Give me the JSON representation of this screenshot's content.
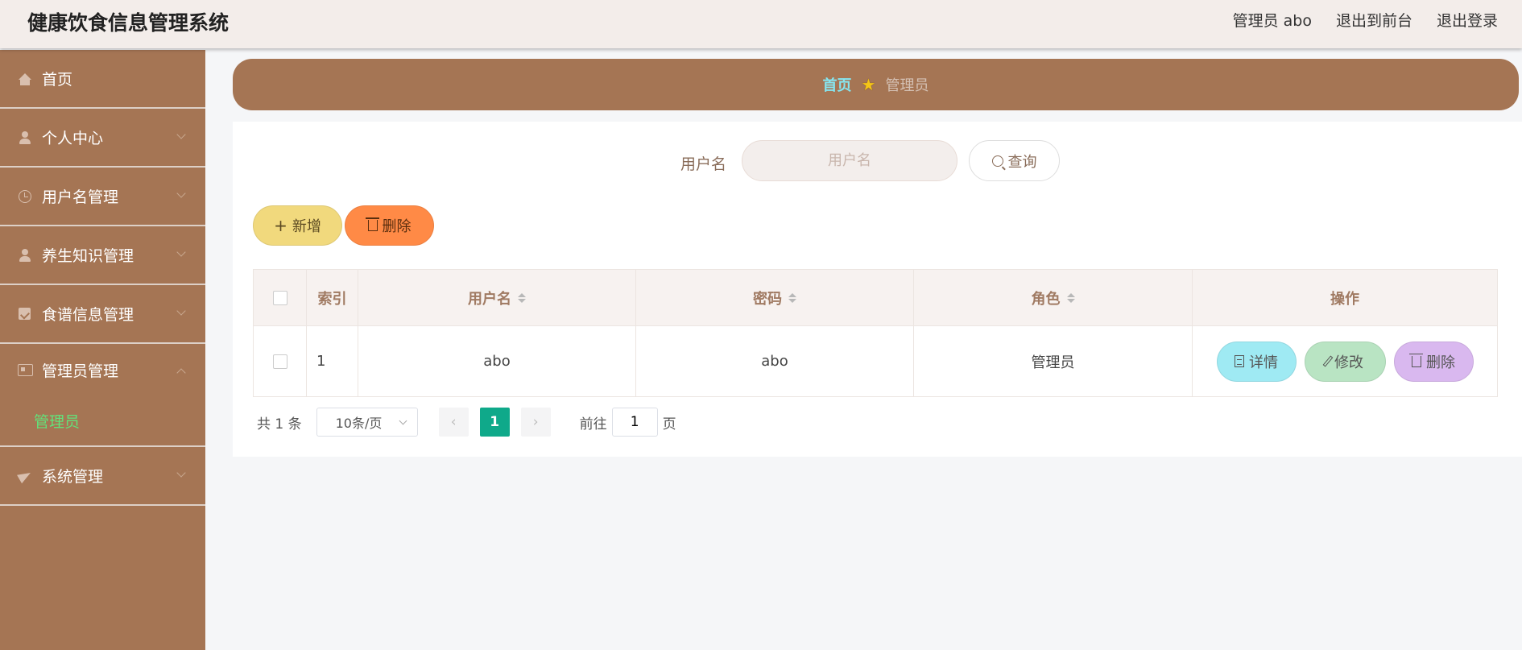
{
  "header": {
    "title": "健康饮食信息管理系统",
    "user_label": "管理员 abo",
    "front_link": "退出到前台",
    "logout_link": "退出登录"
  },
  "sidebar": {
    "items": [
      {
        "label": "首页",
        "icon": "home-icon"
      },
      {
        "label": "个人中心",
        "icon": "user-icon"
      },
      {
        "label": "用户名管理",
        "icon": "clock-icon"
      },
      {
        "label": "养生知识管理",
        "icon": "user-icon"
      },
      {
        "label": "食谱信息管理",
        "icon": "chart-icon"
      },
      {
        "label": "管理员管理",
        "icon": "card-icon",
        "expanded": true
      },
      {
        "label": "系统管理",
        "icon": "send-icon"
      }
    ],
    "sub_items": {
      "admin": "管理员"
    }
  },
  "breadcrumb": {
    "home": "首页",
    "current": "管理员"
  },
  "search": {
    "label": "用户名",
    "placeholder": "用户名",
    "button": "查询"
  },
  "actions": {
    "add": "新增",
    "delete": "删除"
  },
  "table": {
    "headers": [
      "索引",
      "用户名",
      "密码",
      "角色",
      "操作"
    ],
    "rows": [
      {
        "index": "1",
        "username": "abo",
        "password": "abo",
        "role": "管理员"
      }
    ],
    "row_actions": {
      "detail": "详情",
      "edit": "修改",
      "delete": "删除"
    }
  },
  "pagination": {
    "total": "共 1 条",
    "page_size": "10条/页",
    "current_page": "1",
    "jump_label": "前往",
    "jump_value": "1",
    "page_suffix": "页"
  },
  "colors": {
    "sidebar": "#a57554",
    "header_bg": "#f3edea",
    "accent_active": "#62e27a",
    "page_current": "#0fa98a",
    "add_button": "#f1d97d",
    "delete_button": "#ff8a46"
  }
}
